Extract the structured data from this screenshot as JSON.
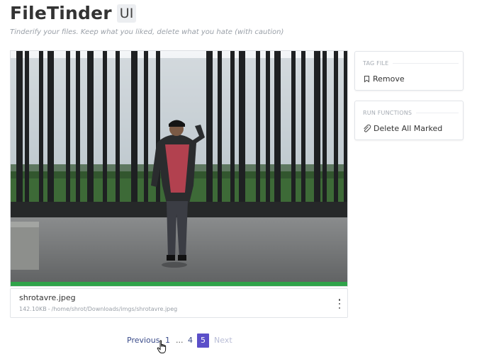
{
  "header": {
    "title": "FileTinder",
    "badge": "UI",
    "subtitle": "Tinderify your files. Keep what you liked, delete what you hate (with caution)"
  },
  "file": {
    "image_description": "photo of a man in a black jacket and red striped shirt walking in front of vertical black metal bars",
    "name": "shrotavre.jpeg",
    "size": "142.10KB",
    "separator": "-",
    "path": "/home/shrot/Downloads/imgs/shrotavre.jpeg",
    "progress_fraction": 1.0
  },
  "sidebar": {
    "tag_file": {
      "heading": "TAG FILE",
      "item_label": "Remove",
      "item_icon": "bookmark-icon"
    },
    "run_functions": {
      "heading": "RUN FUNCTIONS",
      "item_label": "Delete All Marked",
      "item_icon": "paperclip-icon"
    }
  },
  "pagination": {
    "previous": "Previous",
    "first": "1",
    "ellipsis": "...",
    "page4": "4",
    "current": "5",
    "next": "Next"
  },
  "colors": {
    "accent": "#5b4fc9",
    "link": "#3b4c8a",
    "progress": "#2fa34a"
  }
}
